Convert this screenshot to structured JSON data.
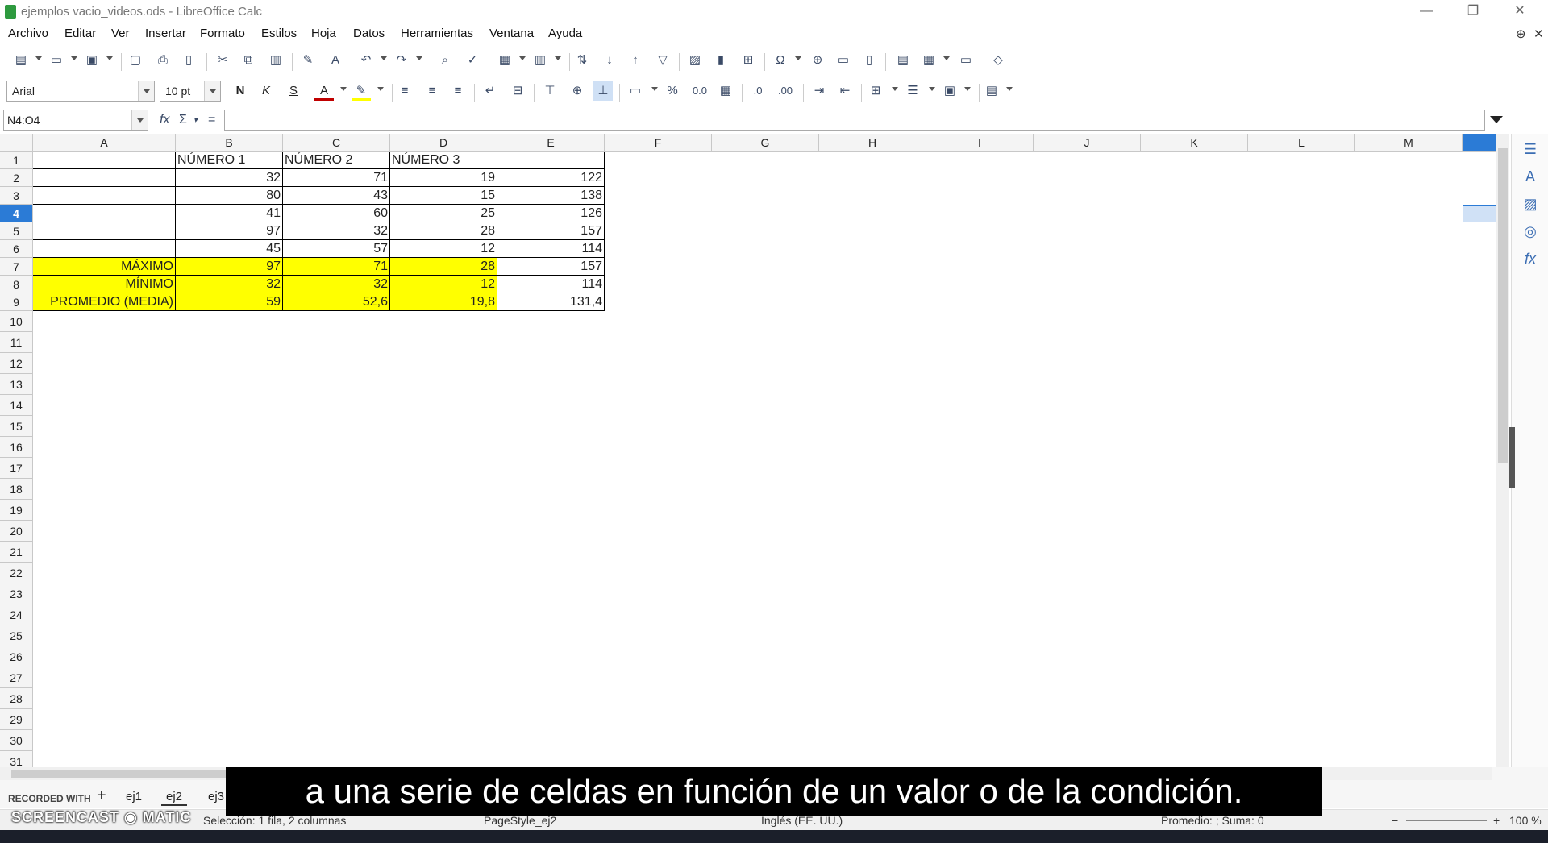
{
  "window": {
    "title": "ejemplos vacio_videos.ods - LibreOffice Calc"
  },
  "menu": [
    "Archivo",
    "Editar",
    "Ver",
    "Insertar",
    "Formato",
    "Estilos",
    "Hoja",
    "Datos",
    "Herramientas",
    "Ventana",
    "Ayuda"
  ],
  "toolbar": {
    "font_name": "Arial",
    "font_size": "10 pt",
    "bold_label": "N",
    "italic_label": "K",
    "strike_label": "S"
  },
  "formula_bar": {
    "name_box": "N4:O4",
    "equals": "="
  },
  "columns": [
    "A",
    "B",
    "C",
    "D",
    "E",
    "F",
    "G",
    "H",
    "I",
    "J",
    "K",
    "L",
    "M"
  ],
  "rows": [
    "1",
    "2",
    "3",
    "4",
    "5",
    "6",
    "7",
    "8",
    "9",
    "10",
    "11",
    "12",
    "13",
    "14",
    "15",
    "16",
    "17",
    "18",
    "19",
    "20",
    "21",
    "22",
    "23",
    "24",
    "25",
    "26",
    "27",
    "28",
    "29",
    "30",
    "31"
  ],
  "table": {
    "header": [
      "",
      "NÚMERO 1",
      "NÚMERO 2",
      "NÚMERO 3",
      ""
    ],
    "data": [
      [
        "",
        "32",
        "71",
        "19",
        "122"
      ],
      [
        "",
        "80",
        "43",
        "15",
        "138"
      ],
      [
        "",
        "41",
        "60",
        "25",
        "126"
      ],
      [
        "",
        "97",
        "32",
        "28",
        "157"
      ],
      [
        "",
        "45",
        "57",
        "12",
        "114"
      ]
    ],
    "stats": [
      [
        "MÁXIMO",
        "97",
        "71",
        "28",
        "157"
      ],
      [
        "MÍNIMO",
        "32",
        "32",
        "12",
        "114"
      ],
      [
        "PROMEDIO (MEDIA)",
        "59",
        "52,6",
        "19,8",
        "131,4"
      ]
    ]
  },
  "sheets": [
    "ej1",
    "ej2",
    "ej3"
  ],
  "active_sheet": "ej2",
  "status": {
    "selection": "Selección: 1 fila, 2 columnas",
    "page_style": "PageStyle_ej2",
    "language": "Inglés (EE. UU.)",
    "sum": "Promedio: ; Suma: 0",
    "zoom": "100 %"
  },
  "overlay": {
    "subtitle": "a una serie de celdas en función de un valor o de la condición.",
    "watermark_top": "RECORDED WITH",
    "watermark_bottom": "SCREENCAST ◉ MATIC"
  },
  "colors": {
    "highlight": "#ffff00",
    "selection": "#2b7bd6"
  }
}
